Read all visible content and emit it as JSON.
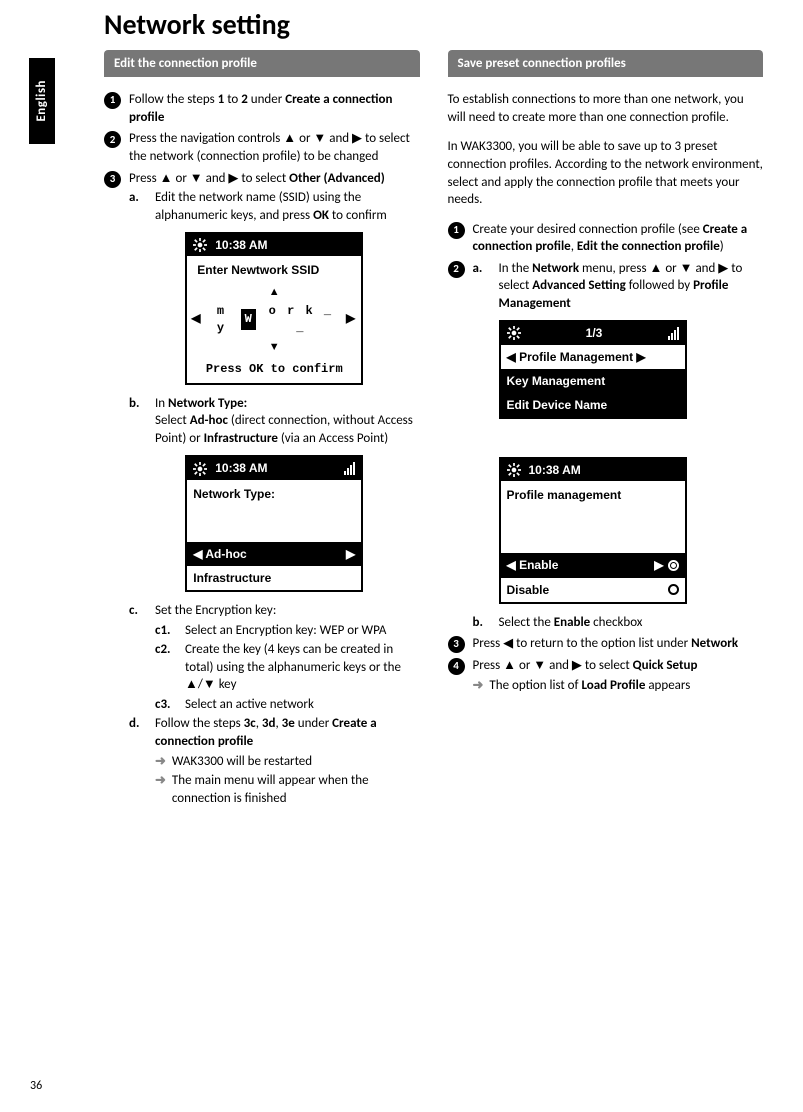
{
  "page": {
    "title": "Network setting",
    "language_tab": "English",
    "page_number": "36"
  },
  "left": {
    "header": "Edit the connection profile",
    "step1": {
      "pre": "Follow the steps ",
      "b1": "1",
      "mid": " to ",
      "b2": "2",
      "mid2": " under ",
      "b3": "Create a connection profile"
    },
    "step2": "Press the navigation controls ▲ or ▼ and ▶ to select the network (connection profile) to be changed",
    "step3": {
      "pre": "Press ▲ or ▼ and ▶ to select ",
      "bold": "Other (Advanced)"
    },
    "s3a": {
      "pre": "Edit the network name (SSID) using the alphanumeric keys, and press ",
      "bold": "OK",
      "post": " to confirm"
    },
    "dev1": {
      "time": "10:38 AM",
      "title": "Enter Newtwork SSID",
      "text_left": "m y",
      "text_box": "W",
      "text_right": "o r k _ _",
      "foot": "Press OK to confirm"
    },
    "s3b": {
      "intro_pre": "In ",
      "intro_bold": "Network Type:",
      "line_pre": "Select ",
      "b1": "Ad-hoc",
      "mid1": " (direct connection, without Access Point) or ",
      "b2": "Infrastructure",
      "post": " (via an Access Point)"
    },
    "dev2": {
      "time": "10:38 AM",
      "title": "Network Type:",
      "sel": "Ad-hoc",
      "unsel": "Infrastructure"
    },
    "s3c": {
      "intro": "Set the Encryption key:",
      "c1": "Select an Encryption key: WEP or WPA",
      "c2": "Create the key (4 keys can be created in total) using the alphanumeric keys or the ▲/▼ key",
      "c3": "Select an active network"
    },
    "s3d": {
      "pre": "Follow the steps ",
      "b1": "3c",
      "c1": ", ",
      "b2": "3d",
      "c2": ", ",
      "b3": "3e",
      "mid": " under ",
      "b4": "Create a connection profile"
    },
    "s3d_arrow1": "WAK3300 will be restarted",
    "s3d_arrow2": "The main menu will appear when the connection is finished"
  },
  "right": {
    "header": "Save preset connection profiles",
    "p1": "To establish connections to more than one network, you will need to create more than one connection profile.",
    "p2": "In WAK3300, you will be able to save up to 3 preset connection profiles. According to the network environment, select and apply the connection profile that meets your needs.",
    "step1": {
      "pre": "Create your desired connection profile (see ",
      "b1": "Create a connection profile",
      "c1": ", ",
      "b2": "Edit the connection profile",
      "post": ")"
    },
    "step2a": {
      "pre": "In the ",
      "b1": "Network",
      "mid1": " menu, press ▲ or ▼ and ▶ to select ",
      "b2": "Advanced Setting",
      "mid2": " followed by ",
      "b3": "Profile Management"
    },
    "dev3": {
      "counter": "1/3",
      "sel": "Profile Management",
      "row2": "Key Management",
      "row3": "Edit Device Name"
    },
    "dev4": {
      "time": "10:38 AM",
      "title": "Profile management",
      "sel": "Enable",
      "unsel": "Disable"
    },
    "step2b": {
      "pre": "Select the ",
      "bold": "Enable",
      "post": " checkbox"
    },
    "step3": {
      "pre": "Press ◀ to return to the option list under ",
      "bold": "Network"
    },
    "step4": {
      "pre": "Press ▲ or ▼ and ▶ to select ",
      "bold": "Quick Setup"
    },
    "step4_arrow": {
      "pre": "The option list of ",
      "bold": "Load Profile",
      "post": " appears"
    }
  }
}
